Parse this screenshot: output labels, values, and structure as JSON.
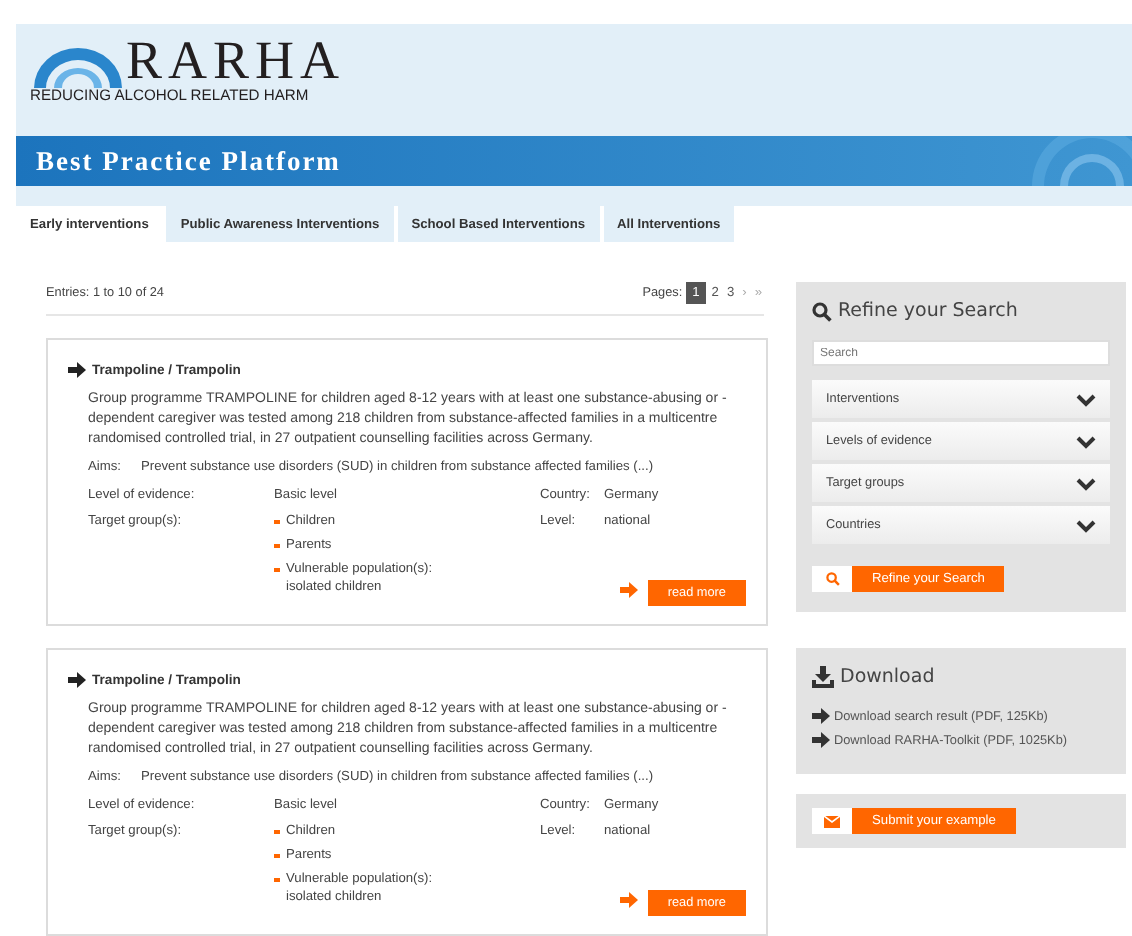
{
  "logo": {
    "name": "RARHA",
    "tagline": "REDUCING ALCOHOL RELATED HARM"
  },
  "banner": {
    "title": "Best Practice Platform"
  },
  "tabs": [
    {
      "label": "Early interventions",
      "selected": true
    },
    {
      "label": "Public Awareness Interventions",
      "selected": false
    },
    {
      "label": "School Based Interventions",
      "selected": false
    },
    {
      "label": "All Interventions",
      "selected": false
    }
  ],
  "results": {
    "entries": "Entries: 1 to 10 of 24",
    "pages_label": "Pages:",
    "pages": [
      {
        "label": "1",
        "selected": true
      },
      {
        "label": "2",
        "selected": false
      },
      {
        "label": "3",
        "selected": false
      }
    ],
    "next": "›",
    "last": "»"
  },
  "cards": [
    {
      "title": "Trampoline / Trampolin",
      "description": "Group programme TRAMPOLINE for children aged 8-12 years with at least one substance-abusing or -dependent caregiver was tested among 218 children from substance-affected families in a multicentre randomised controlled trial, in 27 outpatient counselling facilities across Germany.",
      "aims_label": "Aims:",
      "aims": "Prevent substance use disorders (SUD) in children from substance affected families (...)",
      "evidence_label": "Level of evidence:",
      "evidence": "Basic level",
      "country_label": "Country:",
      "country": "Germany",
      "target_label": "Target group(s):",
      "targets": [
        "Children",
        "Parents",
        "Vulnerable population(s): isolated children"
      ],
      "level_label": "Level:",
      "level": "national",
      "button": "read more"
    },
    {
      "title": "Trampoline / Trampolin",
      "description": "Group programme TRAMPOLINE for children aged 8-12 years with at least one substance-abusing or -dependent caregiver was tested among 218 children from substance-affected families in a multicentre randomised controlled trial, in 27 outpatient counselling facilities across Germany.",
      "aims_label": "Aims:",
      "aims": "Prevent substance use disorders (SUD) in children from substance affected families (...)",
      "evidence_label": "Level of evidence:",
      "evidence": "Basic level",
      "country_label": "Country:",
      "country": "Germany",
      "target_label": "Target group(s):",
      "targets": [
        "Children",
        "Parents",
        "Vulnerable population(s): isolated children"
      ],
      "level_label": "Level:",
      "level": "national",
      "button": "read more"
    }
  ],
  "refine": {
    "title": "Refine your Search",
    "search": {
      "placeholder": "Search"
    },
    "filters": [
      {
        "label": "Interventions",
        "expanded": false
      },
      {
        "label": "Levels of evidence",
        "expanded": false
      },
      {
        "label": "Target groups",
        "expanded": false
      },
      {
        "label": "Countries",
        "expanded": false
      }
    ],
    "button": "Refine your Search"
  },
  "download": {
    "title": "Download",
    "links": [
      "Download search result (PDF, 125Kb)",
      "Download RARHA-Toolkit (PDF, 1025Kb)"
    ]
  },
  "submit": {
    "button": "Submit your example"
  }
}
